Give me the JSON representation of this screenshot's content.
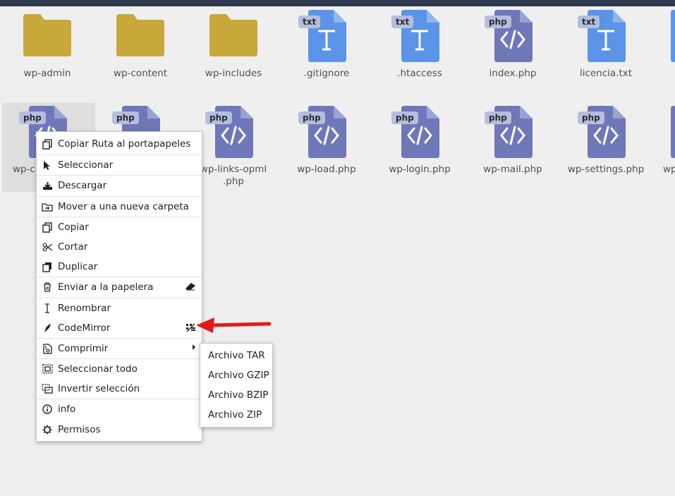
{
  "files_row1": [
    {
      "name": "wp-admin",
      "type": "folder"
    },
    {
      "name": "wp-content",
      "type": "folder"
    },
    {
      "name": "wp-includes",
      "type": "folder"
    },
    {
      "name": ".gitignore",
      "type": "txt",
      "badge": "txt"
    },
    {
      "name": ".htaccess",
      "type": "txt",
      "badge": "txt"
    },
    {
      "name": "index.php",
      "type": "php",
      "badge": "php"
    },
    {
      "name": "licencia.txt",
      "type": "txt",
      "badge": "txt"
    }
  ],
  "files_row2": [
    {
      "name": "wp-c",
      "type": "php",
      "badge": "php"
    },
    {
      "name": "",
      "type": "php",
      "badge": "php"
    },
    {
      "name": "wp-links-opml\n.php",
      "type": "php",
      "badge": "php"
    },
    {
      "name": "wp-load.php",
      "type": "php",
      "badge": "php"
    },
    {
      "name": "wp-login.php",
      "type": "php",
      "badge": "php"
    },
    {
      "name": "wp-mail.php",
      "type": "php",
      "badge": "php"
    },
    {
      "name": "wp-settings.php",
      "type": "php",
      "badge": "php"
    },
    {
      "name": "wp",
      "type": "php",
      "badge": "php"
    }
  ],
  "context_menu": {
    "items": [
      {
        "label": "Copiar Ruta al portapapeles",
        "icon": "copy-icon"
      },
      {
        "label": "Seleccionar",
        "icon": "cursor-icon"
      },
      {
        "label": "Descargar",
        "icon": "download-icon"
      },
      {
        "label": "Mover a una nueva carpeta",
        "icon": "move-folder-icon"
      },
      {
        "label": "Copiar",
        "icon": "copy-icon"
      },
      {
        "label": "Cortar",
        "icon": "scissors-icon"
      },
      {
        "label": "Duplicar",
        "icon": "duplicate-icon"
      },
      {
        "label": "Enviar a la papelera",
        "icon": "trash-icon",
        "shortcut": "eraser-icon"
      },
      {
        "label": "Renombrar",
        "icon": "text-cursor-icon"
      },
      {
        "label": "CodeMirror",
        "icon": "pen-icon",
        "shortcut": "editor-icon"
      },
      {
        "label": "Comprimir",
        "icon": "archive-icon",
        "submenu": true
      },
      {
        "label": "Seleccionar todo",
        "icon": "select-all-icon"
      },
      {
        "label": "Invertir selección",
        "icon": "invert-selection-icon"
      },
      {
        "label": "info",
        "icon": "info-icon"
      },
      {
        "label": "Permisos",
        "icon": "gear-icon"
      }
    ]
  },
  "submenu": {
    "items": [
      "Archivo TAR",
      "Archivo GZIP",
      "Archivo BZIP",
      "Archivo ZIP"
    ]
  },
  "colors": {
    "folder": "#c8a83a",
    "txt": "#5b93e8",
    "php": "#6e78b9",
    "badge": "#b4bede",
    "arrow": "#e01b1b",
    "topbar": "#2f3a4e"
  }
}
